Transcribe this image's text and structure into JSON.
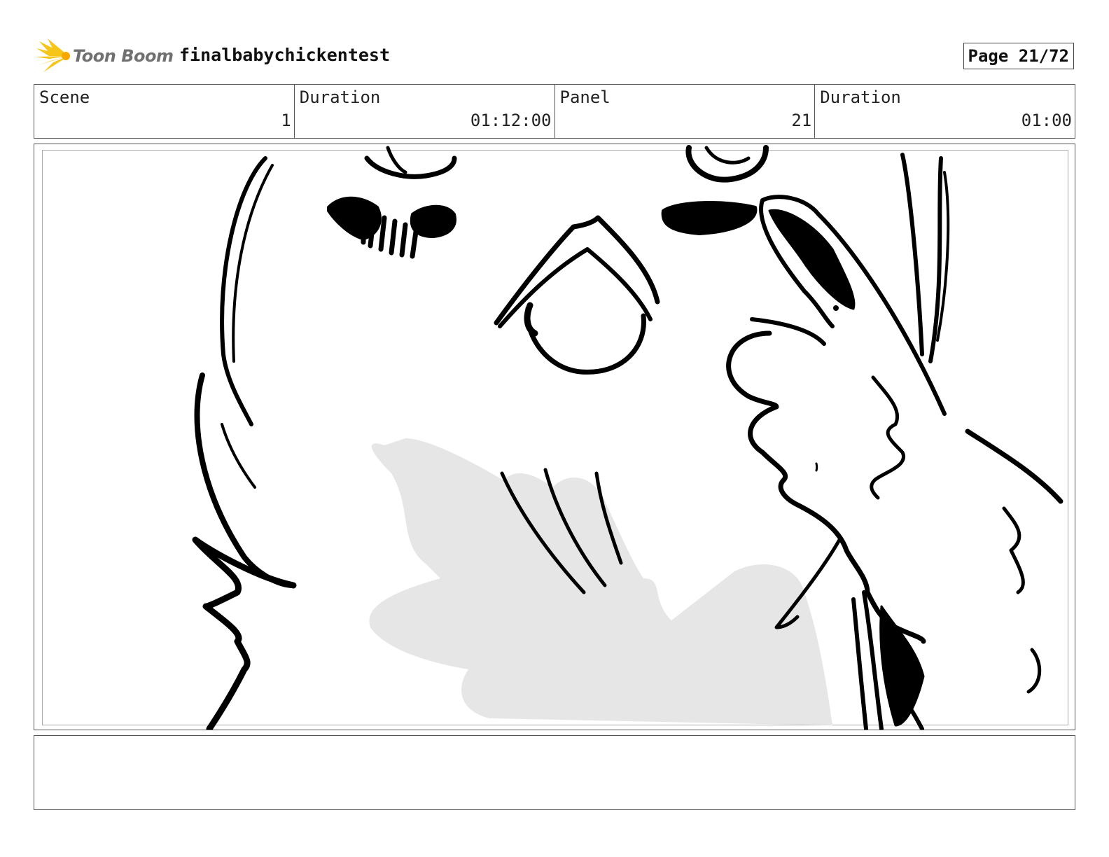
{
  "header": {
    "logo_text": "Toon Boom",
    "project_title": "finalbabychickentest",
    "page_label": "Page 21/72",
    "logo_color": "#f5c518"
  },
  "info": {
    "scene_label": "Scene",
    "scene_value": "1",
    "scene_duration_label": "Duration",
    "scene_duration_value": "01:12:00",
    "panel_label": "Panel",
    "panel_value": "21",
    "panel_duration_label": "Duration",
    "panel_duration_value": "01:00"
  },
  "panel": {
    "image_name": "storyboard-sketch",
    "shadow_color": "#e6e6e6",
    "ink_color": "#000000"
  },
  "notes": {
    "text": ""
  }
}
